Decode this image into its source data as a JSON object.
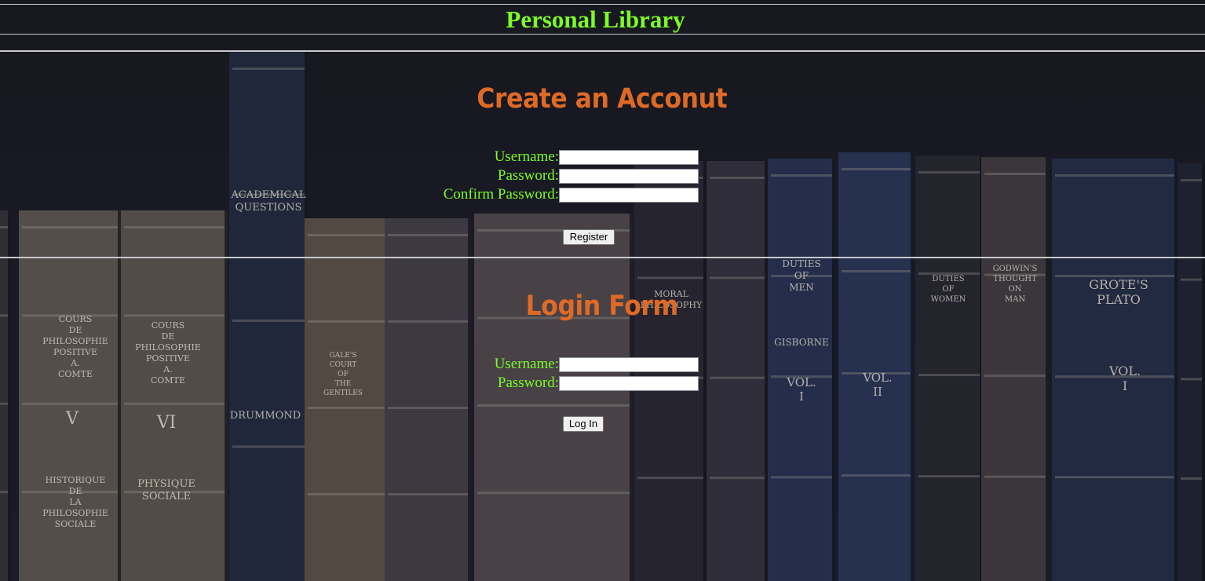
{
  "header": {
    "title": "Personal Library"
  },
  "register": {
    "heading": "Create an Acconut",
    "username_label": "Username:",
    "password_label": "Password:",
    "confirm_label": "Confirm Password:",
    "username_value": "",
    "password_value": "",
    "confirm_value": "",
    "button_label": "Register"
  },
  "login": {
    "heading": "Login Form",
    "username_label": "Username:",
    "password_label": "Password:",
    "username_value": "",
    "password_value": "",
    "button_label": "Log In"
  },
  "background": {
    "spine_titles": [
      "COURS DE PHILOSOPHIE POSITIVE A. COMTE",
      "V",
      "HISTORIQUE DE LA PHILOSOPHIE SOCIALE",
      "COURS DE PHILOSOPHIE POSITIVE A. COMTE",
      "VI",
      "PHYSIQUE SOCIALE",
      "ACADEMICAL QUESTIONS",
      "DRUMMOND",
      "GALE'S COURT OF THE GENTILES",
      "MORAL PHILOSOPHY",
      "DUTIES OF MEN",
      "GISBORNE",
      "VOL. I",
      "VOL. II",
      "DUTIES OF WOMEN",
      "GODWIN'S THOUGHT ON MAN",
      "GROTE'S PLATO",
      "VOL. I"
    ]
  },
  "colors": {
    "accent_green": "#7cfc24",
    "heading_orange": "#de6a25",
    "background_dark": "#15161c"
  }
}
